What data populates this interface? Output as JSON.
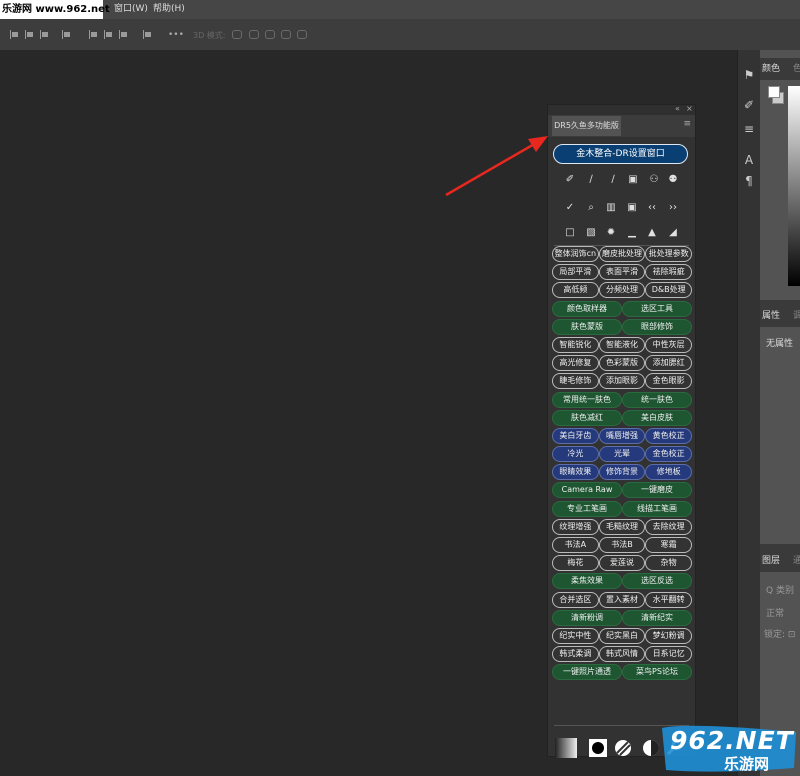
{
  "watermark_top": "乐游网 www.962.net",
  "menu": {
    "items": [
      "窗口(W)",
      "帮助(H)"
    ]
  },
  "options_bar": {
    "more": "•••",
    "mode_3d": "3D 模式:"
  },
  "right_panel": {
    "color_tab": "颜色",
    "color_tab2": "色",
    "properties_tab": "属性",
    "properties_tab2": "调",
    "no_properties": "无属性",
    "layers_tab": "图层",
    "layers_tab2": "通",
    "kind": "Q 类别",
    "normal": "正常",
    "lock": "锁定: ⊡"
  },
  "panel": {
    "tab": "DR5久鱼多功能版",
    "menu_icon": "≡",
    "title_button": "金木整合-DR设置窗口",
    "rows": [
      [
        {
          "t": "整体润饰cn",
          "c": "dark"
        },
        {
          "t": "磨皮批处理",
          "c": "dark"
        },
        {
          "t": "批处理参数",
          "c": "dark"
        }
      ],
      [
        {
          "t": "局部平滑",
          "c": "dark"
        },
        {
          "t": "表面平滑",
          "c": "dark"
        },
        {
          "t": "祛除瑕疵",
          "c": "dark"
        }
      ],
      [
        {
          "t": "高低频",
          "c": "dark"
        },
        {
          "t": "分频处理",
          "c": "dark"
        },
        {
          "t": "D&B处理",
          "c": "dark"
        }
      ],
      [
        {
          "t": "颜色取样器",
          "c": "green"
        },
        {
          "t": "选区工具",
          "c": "green"
        }
      ],
      [
        {
          "t": "肤色蒙版",
          "c": "green"
        },
        {
          "t": "眼部修饰",
          "c": "green"
        }
      ],
      [
        {
          "t": "智能锐化",
          "c": "dark"
        },
        {
          "t": "智能液化",
          "c": "dark"
        },
        {
          "t": "中性灰层",
          "c": "dark"
        }
      ],
      [
        {
          "t": "高光修复",
          "c": "dark"
        },
        {
          "t": "色彩蒙版",
          "c": "dark"
        },
        {
          "t": "添加腮红",
          "c": "dark"
        }
      ],
      [
        {
          "t": "睫毛修饰",
          "c": "dark"
        },
        {
          "t": "添加眼影",
          "c": "dark"
        },
        {
          "t": "金色眼影",
          "c": "dark"
        }
      ],
      [
        {
          "t": "常用统一肤色",
          "c": "green"
        },
        {
          "t": "统一肤色",
          "c": "green"
        }
      ],
      [
        {
          "t": "肤色减红",
          "c": "green"
        },
        {
          "t": "美白皮肤",
          "c": "green"
        }
      ],
      [
        {
          "t": "美白牙齿",
          "c": "blue"
        },
        {
          "t": "嘴唇增强",
          "c": "blue"
        },
        {
          "t": "黄色校正",
          "c": "blue"
        }
      ],
      [
        {
          "t": "冷光",
          "c": "blue"
        },
        {
          "t": "光晕",
          "c": "blue"
        },
        {
          "t": "金色校正",
          "c": "blue"
        }
      ],
      [
        {
          "t": "眼睛效果",
          "c": "blue"
        },
        {
          "t": "修饰背景",
          "c": "blue"
        },
        {
          "t": "修地板",
          "c": "blue"
        }
      ],
      [
        {
          "t": "Camera Raw",
          "c": "green"
        },
        {
          "t": "一键磨皮",
          "c": "green"
        }
      ],
      [
        {
          "t": "专业工笔画",
          "c": "green"
        },
        {
          "t": "线描工笔画",
          "c": "green"
        }
      ],
      [
        {
          "t": "纹理增强",
          "c": "dark"
        },
        {
          "t": "毛糙纹理",
          "c": "dark"
        },
        {
          "t": "去除纹理",
          "c": "dark"
        }
      ],
      [
        {
          "t": "书法A",
          "c": "dark"
        },
        {
          "t": "书法B",
          "c": "dark"
        },
        {
          "t": "寒霜",
          "c": "dark"
        }
      ],
      [
        {
          "t": "梅花",
          "c": "dark"
        },
        {
          "t": "爱莲说",
          "c": "dark"
        },
        {
          "t": "杂物",
          "c": "dark"
        }
      ],
      [
        {
          "t": "柔焦效果",
          "c": "green"
        },
        {
          "t": "选区反选",
          "c": "green"
        }
      ],
      [
        {
          "t": "合并选区",
          "c": "dark"
        },
        {
          "t": "置入素材",
          "c": "dark"
        },
        {
          "t": "水平翻转",
          "c": "dark"
        }
      ],
      [
        {
          "t": "清新粉调",
          "c": "green"
        },
        {
          "t": "清新纪实",
          "c": "green"
        }
      ],
      [
        {
          "t": "纪实中性",
          "c": "dark"
        },
        {
          "t": "纪实黑白",
          "c": "dark"
        },
        {
          "t": "梦幻粉调",
          "c": "dark"
        }
      ],
      [
        {
          "t": "韩式柔调",
          "c": "dark"
        },
        {
          "t": "韩式风情",
          "c": "dark"
        },
        {
          "t": "日系记忆",
          "c": "dark"
        }
      ],
      [
        {
          "t": "一键照片通透",
          "c": "green"
        },
        {
          "t": "菜鸟PS论坛",
          "c": "green"
        }
      ]
    ]
  },
  "watermark": {
    "logo": "962.NET",
    "sub": "乐游网"
  },
  "colors": {
    "title_button": "#0a3f74",
    "green_pill": "#1e5632",
    "blue_pill": "#253a7c",
    "arrow": "#e8281e"
  }
}
